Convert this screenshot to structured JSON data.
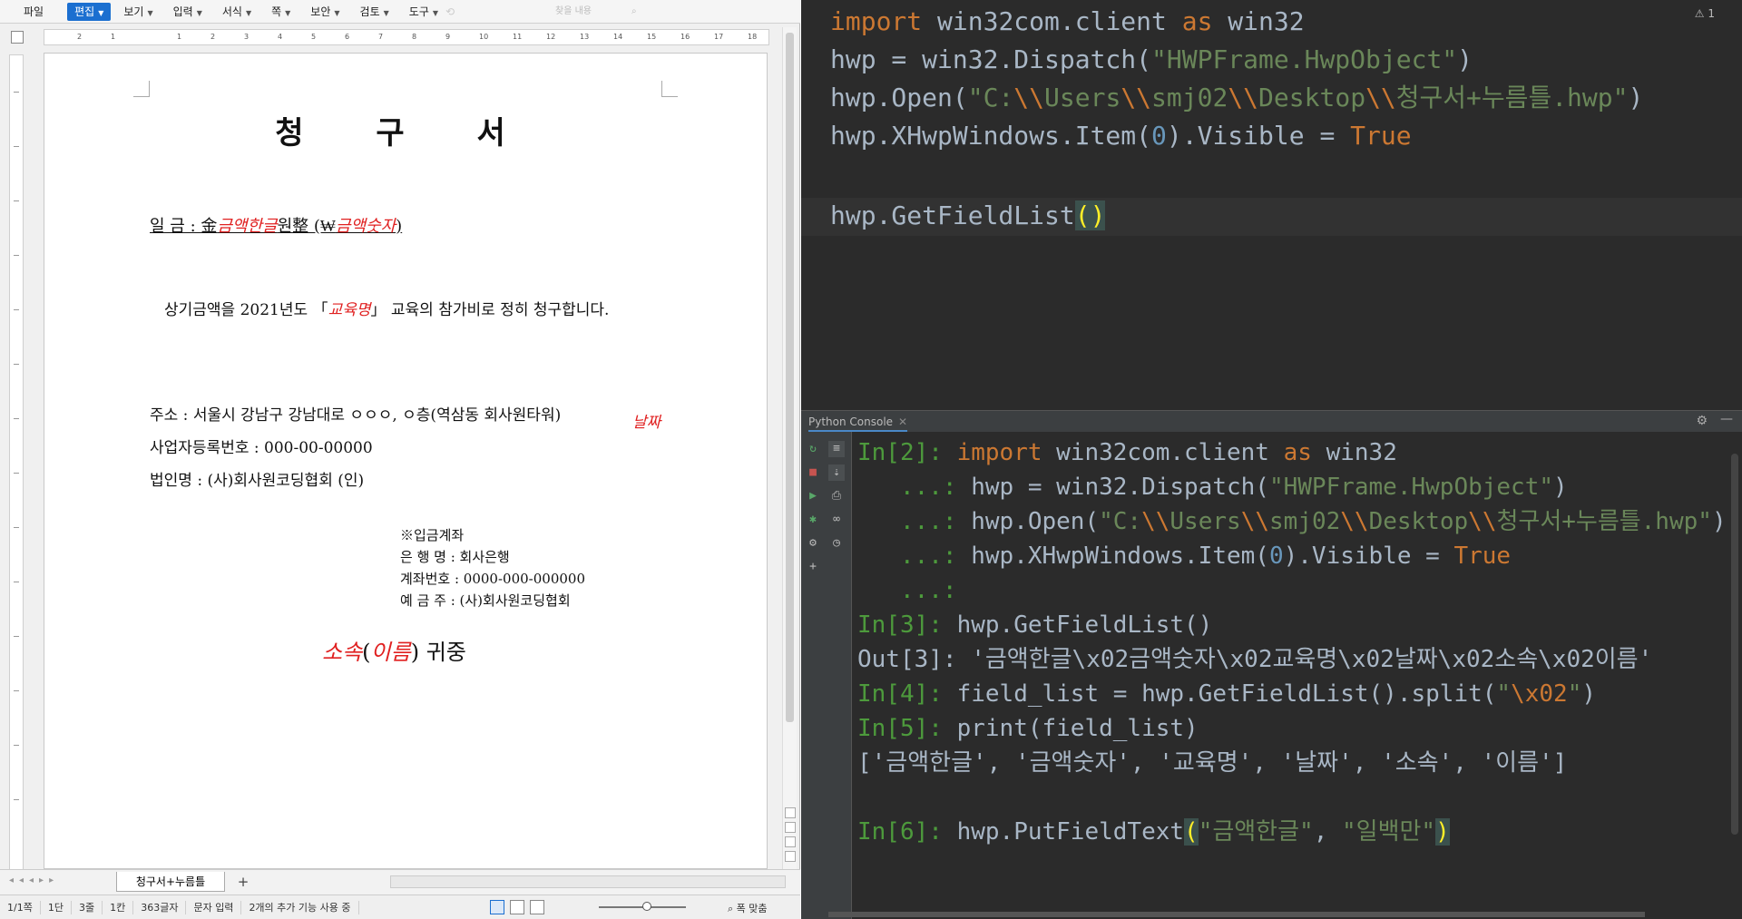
{
  "hwp": {
    "menu": {
      "file": "파일",
      "edit": "편집",
      "view": "보기",
      "input": "입력",
      "format": "서식",
      "page": "쪽",
      "security": "보안",
      "review": "검토",
      "tools": "도구"
    },
    "search_placeholder": "찾을 내용",
    "ruler_ticks": [
      "2",
      "1",
      "1",
      "2",
      "3",
      "4",
      "5",
      "6",
      "7",
      "8",
      "9",
      "10",
      "11",
      "12",
      "13",
      "14",
      "15",
      "16",
      "17",
      "18"
    ],
    "document": {
      "title": "청 구 서",
      "amount_label": "일 금 :  金",
      "amount_field_korean": "금액한글",
      "amount_unit": "원整 (₩",
      "amount_field_number": "금액숫자",
      "amount_close": ")",
      "claim_prefix": "상기금액을 2021년도 「",
      "claim_field_course": "교육명",
      "claim_suffix": "」 교육의 참가비로 정히 청구합니다.",
      "date_field": "날짜",
      "address": "주소 : 서울시 강남구 강남대로 ㅇㅇㅇ, ㅇ층(역삼동 회사원타워)",
      "biz_reg": "사업자등록번호 : 000-00-00000",
      "corp_name": "법인명 : (사)회사원코딩협회        (인)",
      "bank_heading": "※입금계좌",
      "bank_name": "은 행 명 : 회사은행",
      "account_no": "계좌번호 : 0000-000-000000",
      "depositor": "예 금 주 : (사)회사원코딩협회",
      "dest_field_dept": "소속",
      "dest_open": "(",
      "dest_field_name": "이름",
      "dest_close": ")",
      "dest_suffix": " 귀중"
    },
    "doc_tab": "청구서+누름틀",
    "status": {
      "page": "1/1쪽",
      "section": "1단",
      "line": "3줄",
      "column": "1칸",
      "chars": "363글자",
      "mode": "문자 입력",
      "extra": "2개의 추가 기능 사용 중",
      "zoom": "폭 맞춤"
    }
  },
  "ide": {
    "warning_count": "1",
    "console_tab": "Python Console",
    "console_toolbar_icons": [
      "rerun-icon",
      "stop-icon",
      "run-icon",
      "debug-icon",
      "settings-icon",
      "add-icon",
      "soft-wrap-icon",
      "scroll-end-icon",
      "print-icon",
      "variables-icon",
      "history-icon"
    ]
  },
  "colors": {
    "hwp_accent": "#1b6fd0",
    "field_red": "#e02020",
    "ide_bg": "#2b2b2b",
    "keyword": "#cc7832",
    "string": "#6a8759",
    "number": "#6897bb",
    "prompt": "#4d9a3c"
  }
}
